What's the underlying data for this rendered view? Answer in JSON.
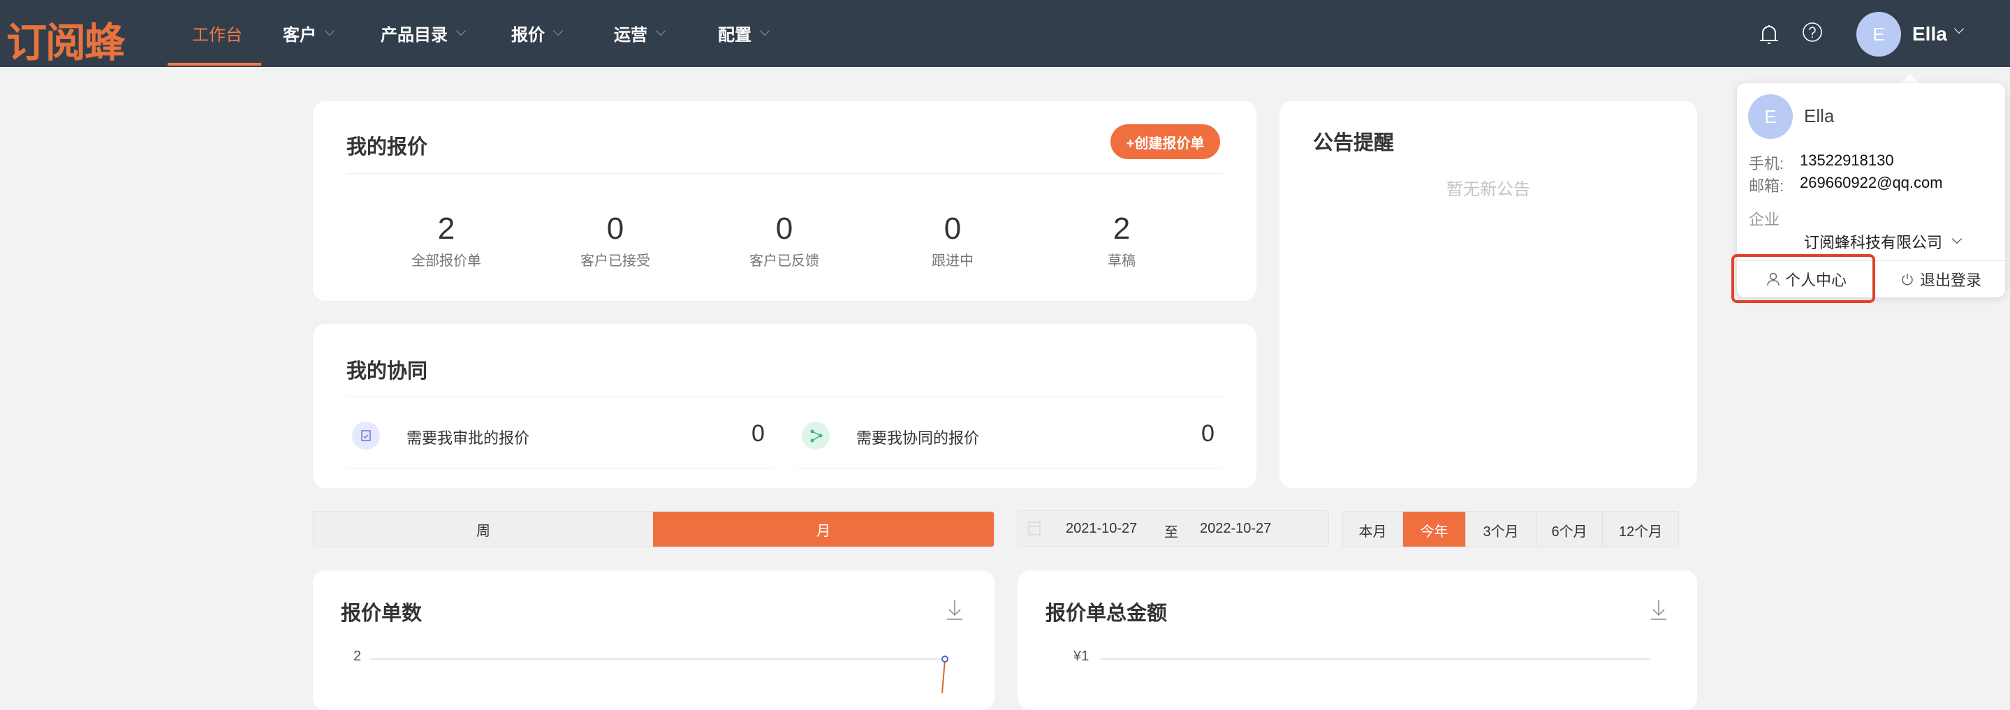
{
  "header": {
    "logo": "订阅蜂",
    "nav": [
      {
        "label": "工作台",
        "active": true
      },
      {
        "label": "客户"
      },
      {
        "label": "产品目录"
      },
      {
        "label": "报价"
      },
      {
        "label": "运营"
      },
      {
        "label": "配置"
      }
    ],
    "user": {
      "initial": "E",
      "name": "Ella"
    }
  },
  "quotes": {
    "title": "我的报价",
    "create_label": "+创建报价单",
    "stats": [
      {
        "value": "2",
        "label": "全部报价单"
      },
      {
        "value": "0",
        "label": "客户已接受"
      },
      {
        "value": "0",
        "label": "客户已反馈"
      },
      {
        "value": "0",
        "label": "跟进中"
      },
      {
        "value": "2",
        "label": "草稿"
      }
    ]
  },
  "collab": {
    "title": "我的协同",
    "items": [
      {
        "label": "需要我审批的报价",
        "count": "0"
      },
      {
        "label": "需要我协同的报价",
        "count": "0"
      }
    ]
  },
  "notice": {
    "title": "公告提醒",
    "empty": "暂无新公告"
  },
  "filters": {
    "period": [
      {
        "label": "周"
      },
      {
        "label": "月",
        "active": true
      }
    ],
    "date_from": "2021-10-27",
    "date_sep": "至",
    "date_to": "2022-10-27",
    "quick": [
      {
        "label": "本月"
      },
      {
        "label": "今年",
        "active": true
      },
      {
        "label": "3个月"
      },
      {
        "label": "6个月"
      },
      {
        "label": "12个月"
      }
    ]
  },
  "charts": [
    {
      "title": "报价单数",
      "y_tick": "2"
    },
    {
      "title": "报价单总金额",
      "y_tick": "¥1"
    }
  ],
  "dropdown": {
    "initial": "E",
    "name": "Ella",
    "phone_label": "手机:",
    "phone": "13522918130",
    "email_label": "邮箱:",
    "email": "269660922@qq.com",
    "company_label": "企业",
    "company": "订阅蜂科技有限公司",
    "profile_label": "个人中心",
    "logout_label": "退出登录"
  },
  "colors": {
    "accent": "#ef6f3f",
    "header": "#333e4d"
  }
}
